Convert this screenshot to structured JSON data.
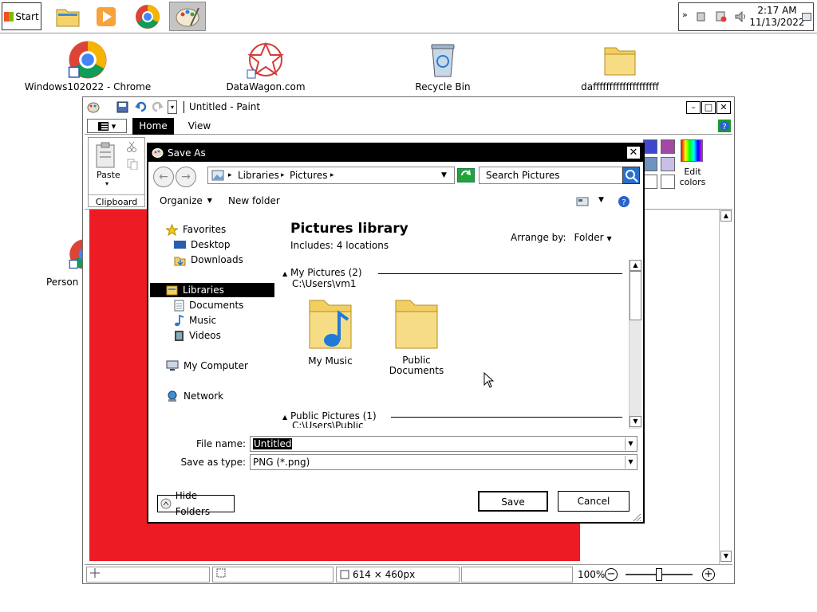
{
  "taskbar": {
    "start_label": "Start",
    "items": [
      {
        "name": "file-explorer",
        "icon": "folder-icon"
      },
      {
        "name": "media-player",
        "icon": "media-player-icon"
      },
      {
        "name": "chrome",
        "icon": "chrome-icon"
      },
      {
        "name": "paint",
        "icon": "paint-icon",
        "active": true
      }
    ],
    "clock": {
      "time": "2:17 AM",
      "date": "11/13/2022"
    },
    "overflow": "»"
  },
  "desktop": {
    "icons": [
      {
        "label": "Windows102022 - Chrome",
        "icon": "chrome-shortcut-icon"
      },
      {
        "label": "DataWagon.com",
        "icon": "datawagon-icon"
      },
      {
        "label": "Recycle Bin",
        "icon": "recycle-bin-icon"
      },
      {
        "label": "daffffffffffffffffffff",
        "icon": "folder-icon"
      },
      {
        "label": "Person",
        "icon": "chrome-shortcut-icon"
      }
    ]
  },
  "paint": {
    "title": "Untitled - Paint",
    "tabs": {
      "file": "▾",
      "home": "Home",
      "view": "View"
    },
    "ribbon": {
      "paste_label": "Paste",
      "clipboard_label": "Clipboard",
      "edit_colors_label": "Edit colors"
    },
    "status": {
      "dimensions": "614 × 460px",
      "zoom": "100%"
    },
    "colors": {
      "canvas": "#ed1c24"
    }
  },
  "dialog": {
    "title": "Save As",
    "breadcrumb": [
      "Libraries",
      "Pictures"
    ],
    "search_placeholder": "Search Pictures",
    "toolbar": {
      "organize": "Organize",
      "new_folder": "New folder"
    },
    "nav": {
      "favorites": "Favorites",
      "favorites_items": [
        "Desktop",
        "Downloads"
      ],
      "libraries": "Libraries",
      "libraries_items": [
        "Documents",
        "Music",
        "Videos"
      ],
      "computer": "My Computer",
      "network": "Network"
    },
    "library": {
      "title": "Pictures library",
      "includes": "Includes:",
      "locations": "4 locations",
      "arrange_label": "Arrange by:",
      "arrange_value": "Folder"
    },
    "sections": [
      {
        "title": "My Pictures (2)",
        "path": "C:\\Users\\vm1"
      },
      {
        "title": "Public Pictures (1)",
        "path": "C:\\Users\\Public"
      }
    ],
    "folders": [
      {
        "label": "My Music",
        "icon": "music-folder-icon"
      },
      {
        "label": "Public Documents",
        "icon": "folder-icon"
      }
    ],
    "file_name_label": "File name:",
    "file_name_value": "Untitled",
    "save_type_label": "Save as type:",
    "save_type_value": "PNG (*.png)",
    "hide_folders": "Hide Folders",
    "save": "Save",
    "cancel": "Cancel"
  }
}
